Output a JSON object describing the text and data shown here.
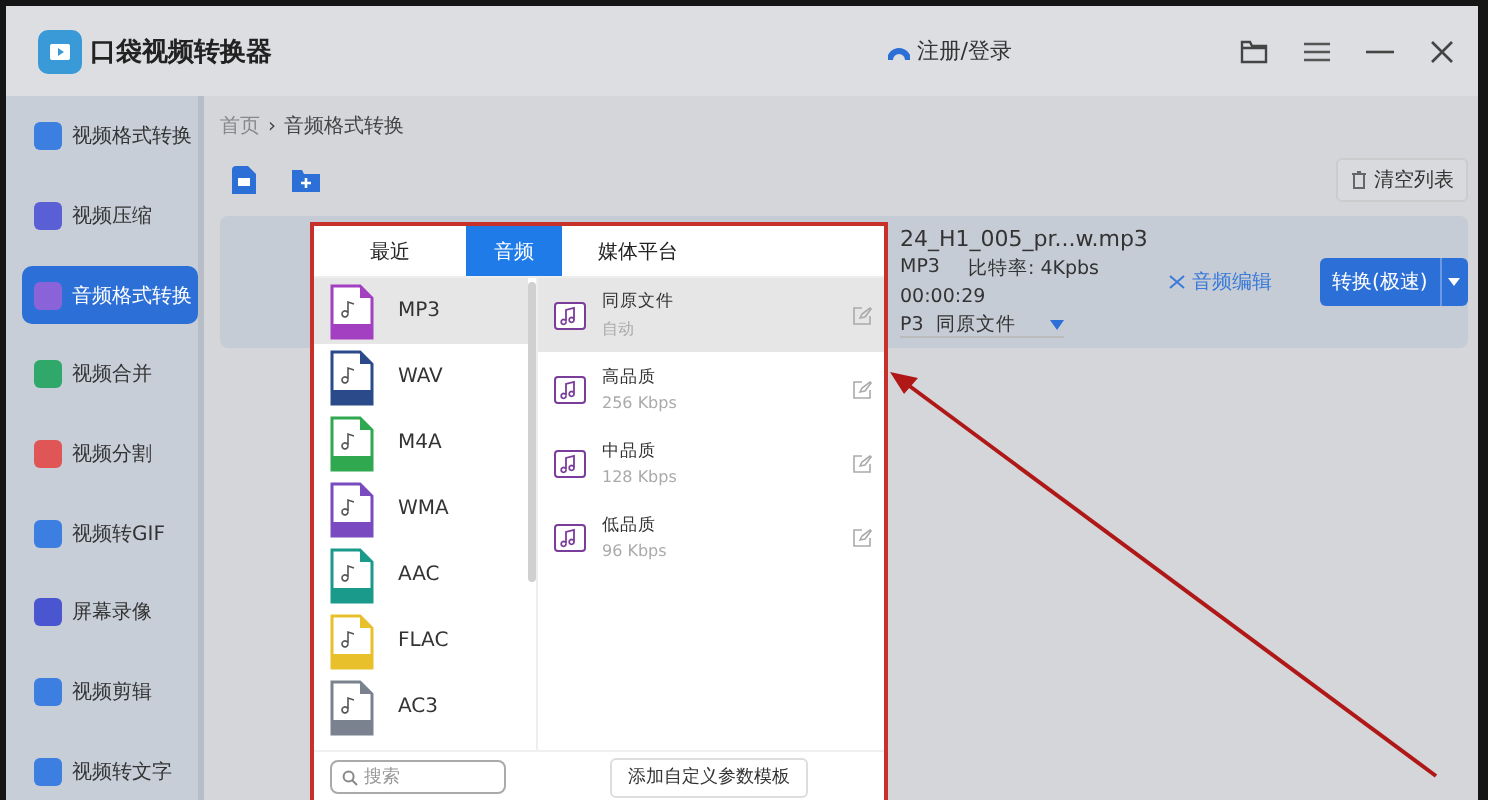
{
  "window": {
    "title": "口袋视频转换器",
    "login": "注册/登录"
  },
  "sidebar": {
    "items": [
      {
        "label": "视频格式转换",
        "selected": false,
        "color": "#3d7fe0"
      },
      {
        "label": "视频压缩",
        "selected": false,
        "color": "#5b5fd6"
      },
      {
        "label": "音频格式转换",
        "selected": true,
        "color": "#8a63d8"
      },
      {
        "label": "视频合并",
        "selected": false,
        "color": "#2fa86a"
      },
      {
        "label": "视频分割",
        "selected": false,
        "color": "#e05555"
      },
      {
        "label": "视频转GIF",
        "selected": false,
        "color": "#3d7fe0"
      },
      {
        "label": "屏幕录像",
        "selected": false,
        "color": "#4a55d0"
      },
      {
        "label": "视频剪辑",
        "selected": false,
        "color": "#3d7fe0"
      },
      {
        "label": "视频转文字",
        "selected": false,
        "color": "#3d7fe0"
      }
    ]
  },
  "breadcrumb": {
    "home": "首页",
    "separator": "›",
    "current": "音频格式转换"
  },
  "clear_button": "清空列表",
  "file": {
    "name": "24_H1_005_pr...w.mp3",
    "format": "MP3",
    "bitrate": "比特率: 4Kpbs",
    "duration": "00:00:29",
    "output": "P3  同原文件",
    "edit_button": "音频编辑",
    "convert_button": "转换(极速)"
  },
  "popup": {
    "tabs": [
      {
        "label": "最近",
        "selected": false
      },
      {
        "label": "音频",
        "selected": true
      },
      {
        "label": "媒体平台",
        "selected": false
      }
    ],
    "formats": [
      {
        "label": "MP3",
        "selected": true,
        "color": "#a33fc1"
      },
      {
        "label": "WAV",
        "selected": false,
        "color": "#2a4a8a"
      },
      {
        "label": "M4A",
        "selected": false,
        "color": "#2fa84f"
      },
      {
        "label": "WMA",
        "selected": false,
        "color": "#7a4bc0"
      },
      {
        "label": "AAC",
        "selected": false,
        "color": "#1a9a8a"
      },
      {
        "label": "FLAC",
        "selected": false,
        "color": "#e8c02c"
      },
      {
        "label": "AC3",
        "selected": false,
        "color": "#7a8290"
      }
    ],
    "presets": [
      {
        "name": "同原文件",
        "detail": "自动",
        "selected": true
      },
      {
        "name": "高品质",
        "detail": "256 Kbps",
        "selected": false
      },
      {
        "name": "中品质",
        "detail": "128 Kbps",
        "selected": false
      },
      {
        "name": "低品质",
        "detail": "96 Kbps",
        "selected": false
      }
    ],
    "search": {
      "placeholder": "搜索"
    },
    "add_template_button": "添加自定义参数模板"
  }
}
